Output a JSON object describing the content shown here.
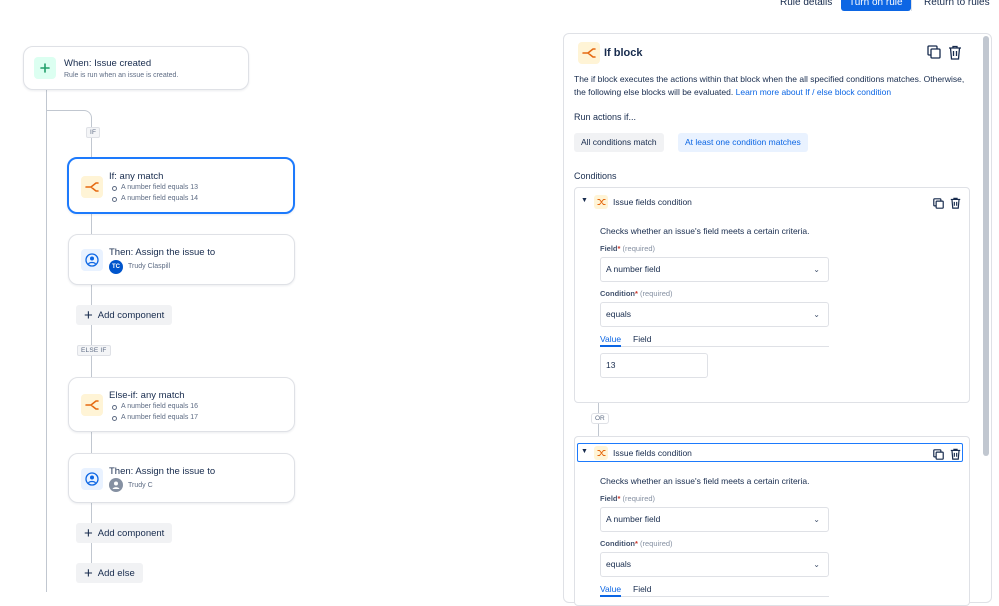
{
  "topbar": {
    "rule_details": "Rule details",
    "turn_on_rule": "Turn on rule",
    "return_to_rules": "Return to rules"
  },
  "flow": {
    "trigger": {
      "title": "When: Issue created",
      "subtitle": "Rule is run when an issue is created."
    },
    "if_tag": "IF",
    "if_block": {
      "title": "If: any match",
      "conditions": [
        "A number field equals 13",
        "A number field equals 14"
      ]
    },
    "then1": {
      "title": "Then: Assign the issue to",
      "assignee": "Trudy Claspill",
      "initials": "TC"
    },
    "add_component_1": "Add component",
    "else_if_tag": "ELSE IF",
    "else_if_block": {
      "title": "Else-if: any match",
      "conditions": [
        "A number field equals 16",
        "A number field equals 17"
      ]
    },
    "then2": {
      "title": "Then: Assign the issue to",
      "assignee": "Trudy C"
    },
    "add_component_2": "Add component",
    "add_else": "Add else"
  },
  "panel": {
    "title": "If block",
    "description": "The if block executes the actions within that block when the all specified conditions matches. Otherwise, the following else blocks will be evaluated.",
    "learn_more": "Learn more about If / else block condition",
    "run_actions_label": "Run actions if...",
    "option_all": "All conditions match",
    "option_any": "At least one condition matches",
    "conditions_label": "Conditions",
    "or_label": "OR",
    "conditions": [
      {
        "name": "Issue fields condition",
        "description": "Checks whether an issue's field meets a certain criteria.",
        "field_label": "Field",
        "field_hint": "(required)",
        "field_value": "A number field",
        "condition_label": "Condition",
        "condition_hint": "(required)",
        "condition_value": "equals",
        "tab_value": "Value",
        "tab_field": "Field",
        "value": "13"
      },
      {
        "name": "Issue fields condition",
        "description": "Checks whether an issue's field meets a certain criteria.",
        "field_label": "Field",
        "field_hint": "(required)",
        "field_value": "A number field",
        "condition_label": "Condition",
        "condition_hint": "(required)",
        "condition_value": "equals",
        "tab_value": "Value",
        "tab_field": "Field"
      }
    ]
  },
  "colors": {
    "primary": "#0c66e4",
    "branch_icon_bg": "#fff4d6",
    "branch_icon": "#e56910",
    "trigger_icon_bg": "#dcfff1",
    "trigger_icon": "#22a06b",
    "selected_border": "#1d7afc"
  },
  "icons": [
    "plus-icon",
    "branch-icon",
    "user-circle-icon",
    "copy-icon",
    "trash-icon",
    "shuffle-icon",
    "chevron-down-icon"
  ]
}
